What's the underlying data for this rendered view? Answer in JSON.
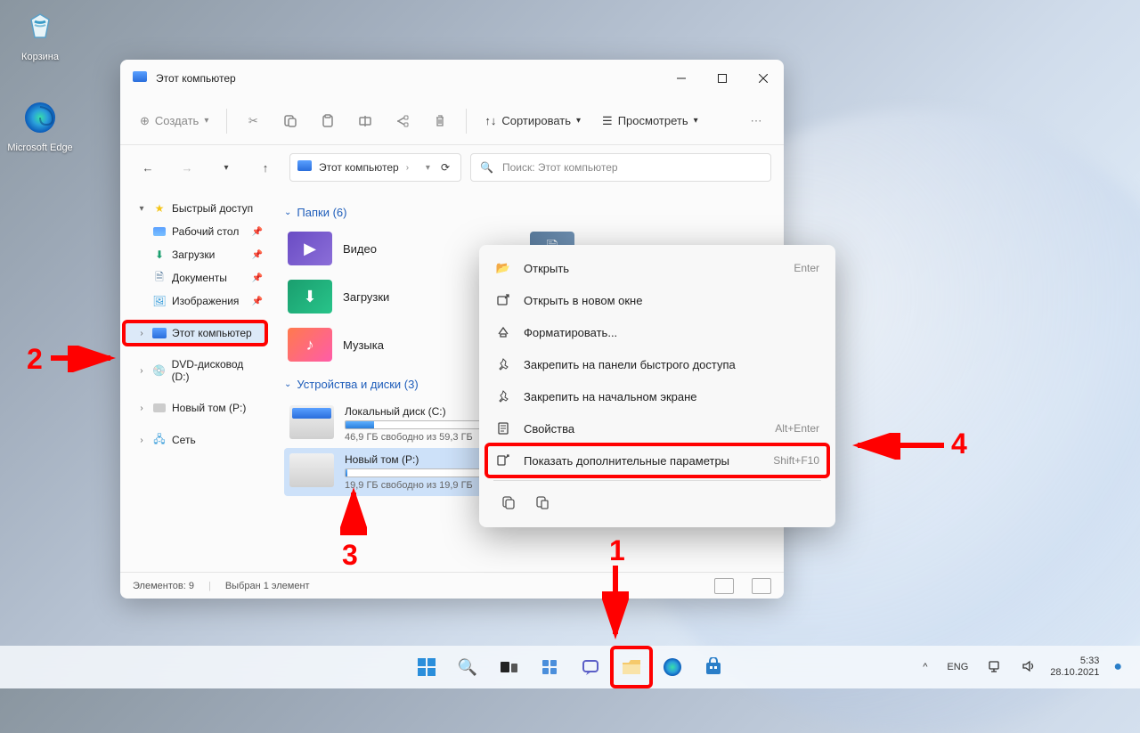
{
  "desktop": {
    "icons": [
      {
        "name": "recycle-bin",
        "label": "Корзина"
      },
      {
        "name": "edge",
        "label": "Microsoft Edge"
      }
    ]
  },
  "window": {
    "title": "Этот компьютер",
    "toolbar": {
      "create": "Создать",
      "sort": "Сортировать",
      "view": "Просмотреть"
    },
    "breadcrumb": "Этот компьютер",
    "search_placeholder": "Поиск: Этот компьютер",
    "sidebar": {
      "quick_access": "Быстрый доступ",
      "desktop": "Рабочий стол",
      "downloads": "Загрузки",
      "documents": "Документы",
      "pictures": "Изображения",
      "this_pc": "Этот компьютер",
      "dvd": "DVD-дисковод (D:)",
      "new_vol": "Новый том (P:)",
      "network": "Сеть"
    },
    "sections": {
      "folders": "Папки (6)",
      "drives": "Устройства и диски (3)"
    },
    "folders": {
      "video": "Видео",
      "downloads": "Загрузки",
      "music": "Музыка",
      "documents": "Документы"
    },
    "drives": {
      "c_name": "Локальный диск (C:)",
      "c_free": "46,9 ГБ свободно из 59,3 ГБ",
      "c_fill_pct": 21,
      "p_name": "Новый том (P:)",
      "p_free": "19,9 ГБ свободно из 19,9 ГБ",
      "p_fill_pct": 1
    },
    "status": {
      "count": "Элементов: 9",
      "selected": "Выбран 1 элемент"
    }
  },
  "context_menu": {
    "open": "Открыть",
    "open_sc": "Enter",
    "open_new": "Открыть в новом окне",
    "format": "Форматировать...",
    "pin_quick": "Закрепить на панели быстрого доступа",
    "pin_start": "Закрепить на начальном экране",
    "properties": "Свойства",
    "properties_sc": "Alt+Enter",
    "show_more": "Показать дополнительные параметры",
    "show_more_sc": "Shift+F10"
  },
  "annotations": {
    "n1": "1",
    "n2": "2",
    "n3": "3",
    "n4": "4"
  },
  "taskbar": {
    "lang": "ENG",
    "time": "5:33",
    "date": "28.10.2021"
  }
}
